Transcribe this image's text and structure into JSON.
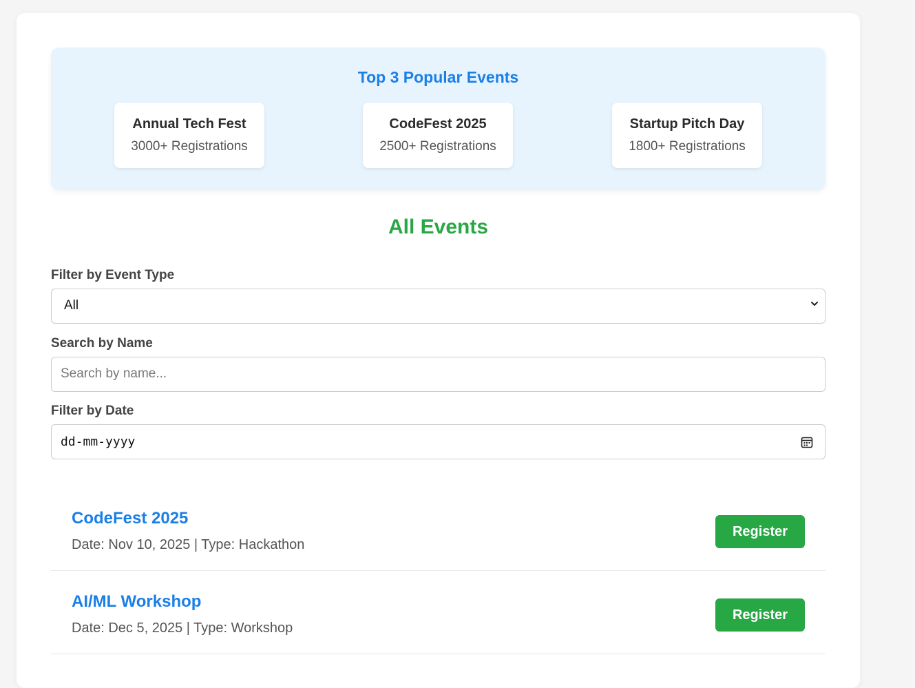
{
  "popular": {
    "title": "Top 3 Popular Events",
    "events": [
      {
        "name": "Annual Tech Fest",
        "registrations": "3000+ Registrations"
      },
      {
        "name": "CodeFest 2025",
        "registrations": "2500+ Registrations"
      },
      {
        "name": "Startup Pitch Day",
        "registrations": "1800+ Registrations"
      }
    ]
  },
  "all_events": {
    "title": "All Events"
  },
  "filters": {
    "type_label": "Filter by Event Type",
    "type_value": "All",
    "search_label": "Search by Name",
    "search_placeholder": "Search by name...",
    "date_label": "Filter by Date",
    "date_value": "dd-mm-yyyy"
  },
  "events": [
    {
      "name": "CodeFest 2025",
      "meta": "Date: Nov 10, 2025 | Type: Hackathon",
      "button": "Register"
    },
    {
      "name": "AI/ML Workshop",
      "meta": "Date: Dec 5, 2025 | Type: Workshop",
      "button": "Register"
    }
  ],
  "colors": {
    "accent_blue": "#1a7fe6",
    "accent_green": "#28a745",
    "popular_bg": "#e8f4fd"
  }
}
